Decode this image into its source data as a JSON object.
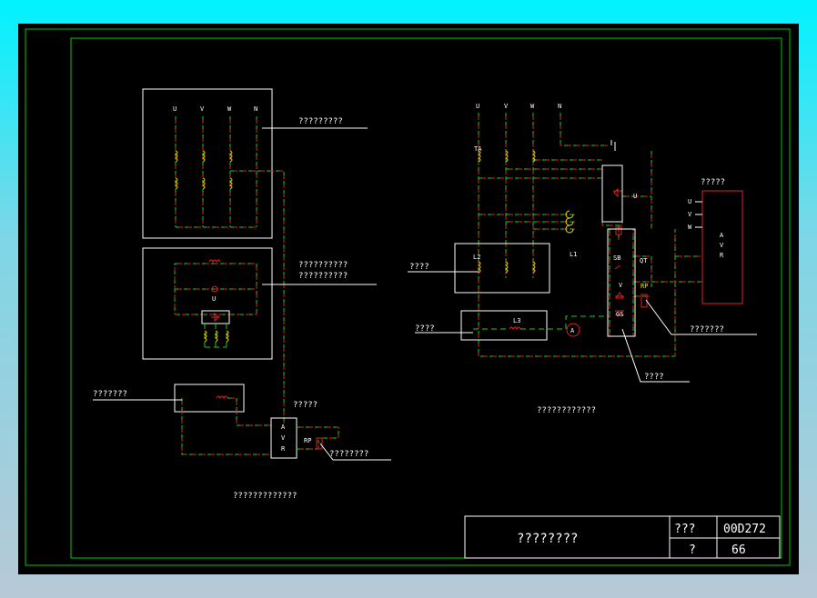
{
  "colors": {
    "frame": "#00c800",
    "wire_green": "#19d11e",
    "wire_red": "#e02020",
    "text": "#ffffff",
    "yellow": "#e6e600"
  },
  "left": {
    "phase_labels": [
      "U",
      "V",
      "W",
      "N"
    ],
    "callout_top": "?????????",
    "callout_mid_1": "??????????",
    "callout_mid_2": "??????????",
    "u_label": "U",
    "callout_left": "???????",
    "callout_avr": "?????",
    "avr_letters": [
      "A",
      "V",
      "R"
    ],
    "rp_label": "RP",
    "callout_rp": "????????",
    "caption": "?????????????"
  },
  "right": {
    "phase_labels": [
      "U",
      "V",
      "W",
      "N"
    ],
    "ta_label": "TA",
    "u_label": "U",
    "l1_label": "L1",
    "l2_label": "L2",
    "l3_label": "L3",
    "sb_label": "SB",
    "v_label": "V",
    "gs_label": "GS",
    "qt_label": "QT",
    "rp_label": "RP",
    "ammeter": "A",
    "callout_l2": "????",
    "callout_l3": "????",
    "callout_avr_top": "?????",
    "avr_inputs": [
      "U",
      "V",
      "W"
    ],
    "avr_letters": [
      "A",
      "V",
      "R"
    ],
    "callout_rp": "???????",
    "callout_bottom": "????",
    "caption": "????????????"
  },
  "title_block": {
    "title": "????????",
    "label_1": "???",
    "value_1": "00D272",
    "label_2": "?",
    "value_2": "66"
  }
}
